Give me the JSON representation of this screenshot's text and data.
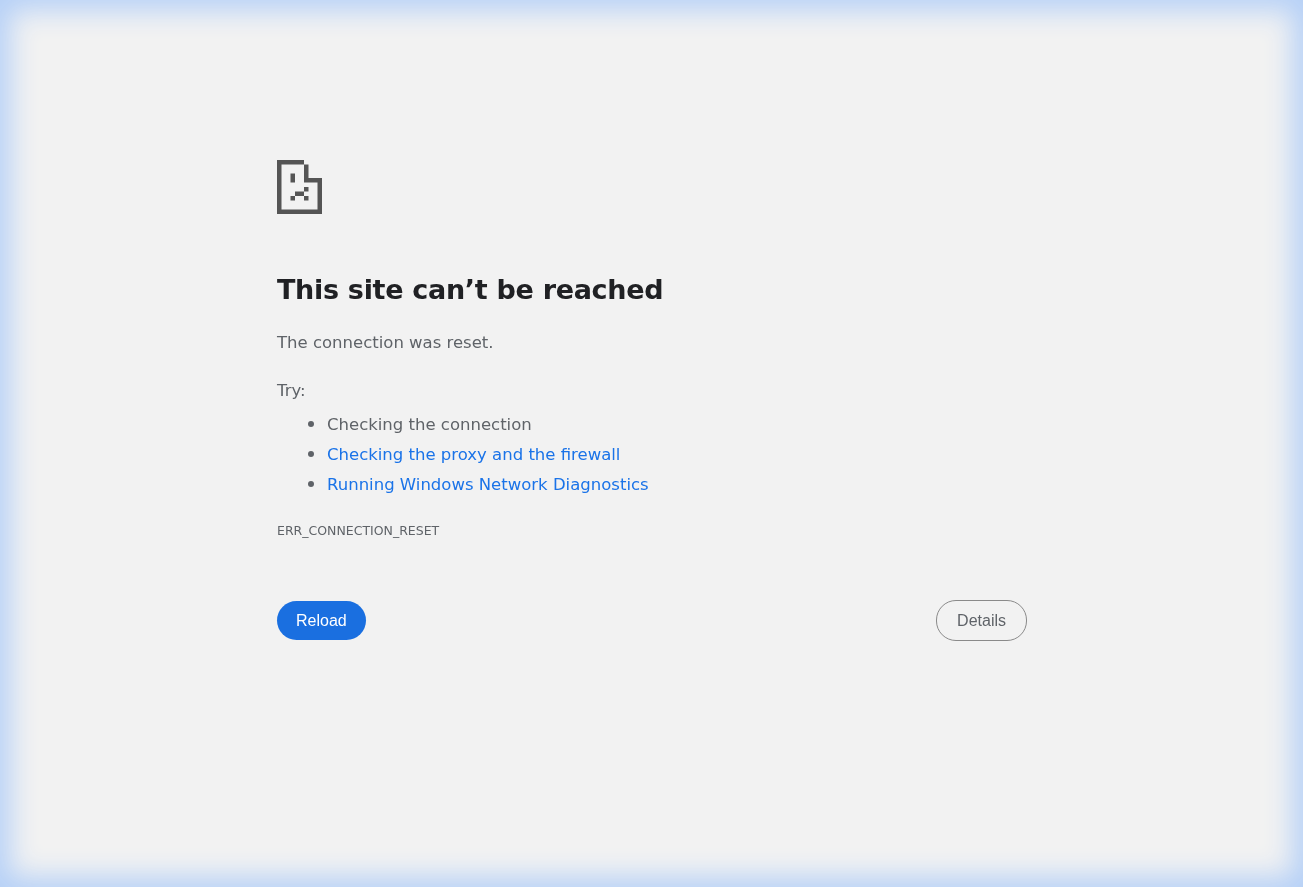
{
  "heading": "This site can’t be reached",
  "message": "The connection was reset.",
  "try_label": "Try:",
  "suggestions": [
    {
      "kind": "text",
      "label": "Checking the connection"
    },
    {
      "kind": "link",
      "label": "Checking the proxy and the firewall"
    },
    {
      "kind": "link",
      "label": "Running Windows Network Diagnostics"
    }
  ],
  "error_code": "ERR_CONNECTION_RESET",
  "buttons": [
    {
      "kind": "primary",
      "label": "Reload"
    },
    {
      "kind": "secondary",
      "label": "Details"
    }
  ]
}
